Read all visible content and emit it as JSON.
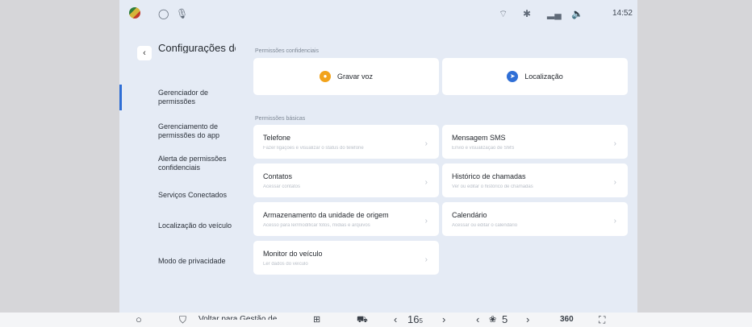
{
  "status": {
    "time": "14:52",
    "icons": [
      "flag-icon",
      "circle-icon",
      "mic-icon",
      "wifi-icon",
      "bluetooth-icon",
      "signal-icon",
      "volume-icon"
    ]
  },
  "sidebar": {
    "back_icon": "‹",
    "title": "Configurações de privacidade e",
    "items": [
      {
        "label": "Gerenciador de permissões",
        "active": true
      },
      {
        "label": "Gerenciamento de permissões do app",
        "active": false
      },
      {
        "label": "Alerta de permissões confidenciais",
        "active": false
      },
      {
        "label": "Serviços Conectados",
        "active": false
      },
      {
        "label": "Localização do veículo",
        "active": false
      },
      {
        "label": "Modo de privacidade",
        "active": false
      }
    ]
  },
  "main": {
    "confidential_label": "Permissões confidenciais",
    "confidential": [
      {
        "label": "Gravar voz",
        "color": "#f2a31b"
      },
      {
        "label": "Localização",
        "color": "#2f6fd6"
      }
    ],
    "basic_label": "Permissões básicas",
    "basic": [
      {
        "title": "Telefone",
        "sub": "Fazer ligações e visualizar o status do telefone"
      },
      {
        "title": "Mensagem SMS",
        "sub": "Envio e visualização de SMS"
      },
      {
        "title": "Contatos",
        "sub": "Acessar contatos"
      },
      {
        "title": "Histórico de chamadas",
        "sub": "Ver ou editar o histórico de chamadas"
      },
      {
        "title": "Armazenamento da unidade de origem",
        "sub": "Acesso para ler/modificar fotos, mídias e arquivos"
      },
      {
        "title": "Calendário",
        "sub": "Acessar ou editar o calendário"
      },
      {
        "title": "Monitor do veículo",
        "sub": "Ler dados do veículo"
      }
    ],
    "chevron": "›"
  },
  "dock": {
    "home_icon": "○",
    "safety_text": "Voltar para Gestão de Segurança",
    "temp_left": "16",
    "temp_left_sub": "5",
    "fan": "5",
    "prev_icon": "‹",
    "next_icon": "›",
    "cam": "360"
  }
}
